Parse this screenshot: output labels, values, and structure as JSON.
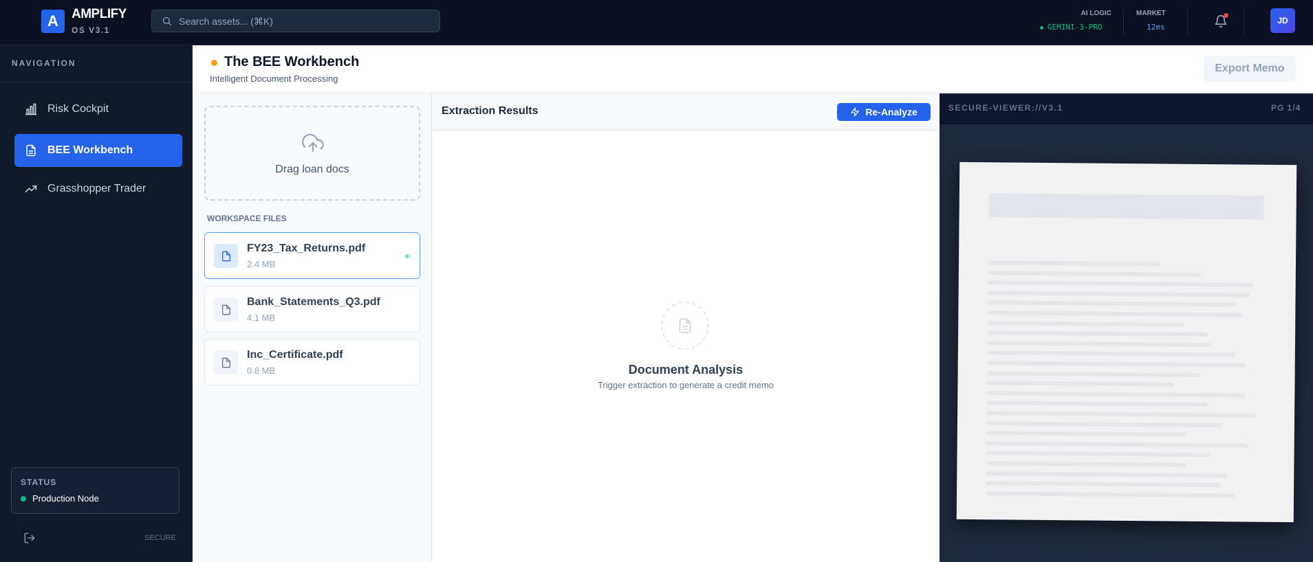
{
  "app": {
    "logo_letter": "A",
    "name": "AMPLIFY",
    "version": "OS V3.1"
  },
  "search": {
    "placeholder": "Search assets... (⌘K)",
    "icon": "search-icon"
  },
  "topbar": {
    "ailogic_label": "AI LOGIC",
    "ailogic_value": "GEMINI-3-PRO",
    "market_label": "MARKET",
    "market_value": "12ms",
    "bell_icon": "bell-icon",
    "avatar_initials": "JD"
  },
  "sidebar": {
    "title": "NAVIGATION",
    "items": [
      {
        "label": "Risk Cockpit",
        "icon": "bar-chart-icon",
        "active": false
      },
      {
        "label": "BEE Workbench",
        "icon": "document-icon",
        "active": true
      },
      {
        "label": "Grasshopper Trader",
        "icon": "trending-up-icon",
        "active": false
      }
    ],
    "status": {
      "title": "STATUS",
      "value": "Production Node"
    },
    "footer_tag": "SECURE"
  },
  "header": {
    "title": "The BEE Workbench",
    "subtitle": "Intelligent Document Processing",
    "export_label": "Export Memo"
  },
  "files": {
    "dropzone_label": "Drag loan docs",
    "section_title": "WORKSPACE FILES",
    "items": [
      {
        "name": "FY23_Tax_Returns.pdf",
        "size": "2.4 MB",
        "selected": true
      },
      {
        "name": "Bank_Statements_Q3.pdf",
        "size": "4.1 MB",
        "selected": false
      },
      {
        "name": "Inc_Certificate.pdf",
        "size": "0.8 MB",
        "selected": false
      }
    ]
  },
  "extraction": {
    "title": "Extraction Results",
    "reanalyze_label": "Re-Analyze",
    "empty_title": "Document Analysis",
    "empty_subtitle": "Trigger extraction to generate a credit memo"
  },
  "viewer": {
    "title": "SECURE-VIEWER://V3.1",
    "page_indicator": "PG 1/4"
  },
  "colors": {
    "accent": "#2563eb",
    "topbar_bg": "#0b1121",
    "sidebar_bg": "#111827",
    "status_green": "#10b981",
    "warning_dot": "#f59e0b",
    "viewer_bg": "#1e293b"
  }
}
